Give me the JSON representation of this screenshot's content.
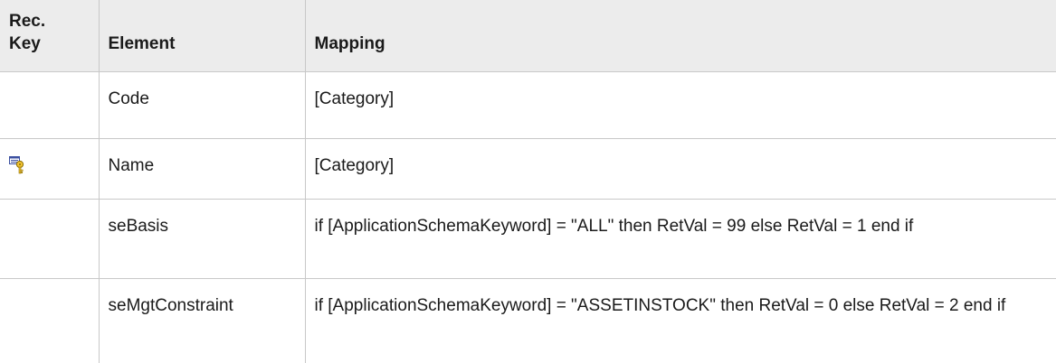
{
  "table": {
    "headers": {
      "rec_key_line1": "Rec.",
      "rec_key_line2": "Key",
      "element": "Element",
      "mapping": "Mapping"
    },
    "rows": [
      {
        "rec_key_icon": "",
        "element": "Code",
        "mapping": "[Category]"
      },
      {
        "rec_key_icon": "reconciliation-key-icon",
        "element": "Name",
        "mapping": "[Category]"
      },
      {
        "rec_key_icon": "",
        "element": "seBasis",
        "mapping": "if [ApplicationSchemaKeyword] = \"ALL\" then RetVal = 99 else RetVal = 1 end if"
      },
      {
        "rec_key_icon": "",
        "element": "seMgtConstraint",
        "mapping": "if [ApplicationSchemaKeyword] = \"ASSETINSTOCK\" then RetVal = 0 else RetVal = 2 end if"
      }
    ]
  }
}
